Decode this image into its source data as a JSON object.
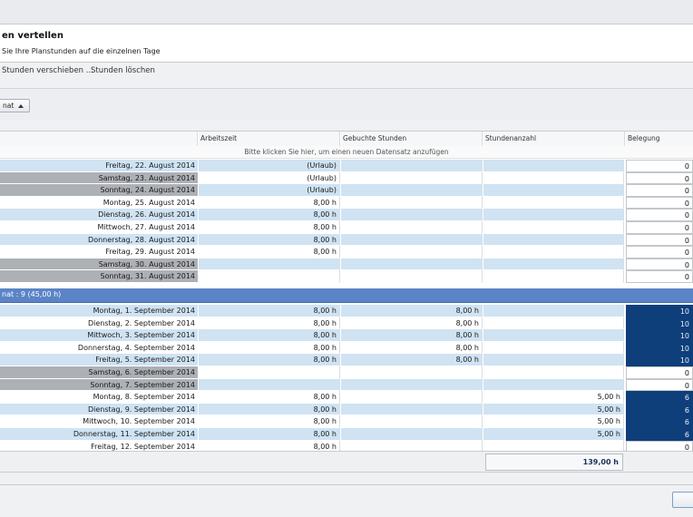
{
  "header": {
    "title": "en vertellen",
    "subtitle": "Sie Ihre Planstunden auf die einzelnen Tage"
  },
  "toolbar": {
    "move_label": "Stunden verschieben ...",
    "delete_label": "Stunden löschen"
  },
  "group_panel": {
    "chip_label": "nat"
  },
  "grid": {
    "columns": [
      "Arbeitszeit",
      "Gebuchte Stunden",
      "Stundenanzahl",
      "Belegung"
    ],
    "new_row_hint": "Bitte klicken Sie hier, um einen neuen Datensatz anzufügen",
    "rows_august": [
      {
        "date": "Freitag, 22. August 2014",
        "arbeitszeit": "(Urlaub)",
        "gebucht": "",
        "stunden": "",
        "belegung": "0"
      },
      {
        "date": "Samstag, 23. August 2014",
        "arbeitszeit": "(Urlaub)",
        "gebucht": "",
        "stunden": "",
        "belegung": "0"
      },
      {
        "date": "Sonntag, 24. August 2014",
        "arbeitszeit": "(Urlaub)",
        "gebucht": "",
        "stunden": "",
        "belegung": "0"
      },
      {
        "date": "Montag, 25. August 2014",
        "arbeitszeit": "8,00 h",
        "gebucht": "",
        "stunden": "",
        "belegung": "0"
      },
      {
        "date": "Dienstag, 26. August 2014",
        "arbeitszeit": "8,00 h",
        "gebucht": "",
        "stunden": "",
        "belegung": "0"
      },
      {
        "date": "Mittwoch, 27. August 2014",
        "arbeitszeit": "8,00 h",
        "gebucht": "",
        "stunden": "",
        "belegung": "0"
      },
      {
        "date": "Donnerstag, 28. August 2014",
        "arbeitszeit": "8,00 h",
        "gebucht": "",
        "stunden": "",
        "belegung": "0"
      },
      {
        "date": "Freitag, 29. August 2014",
        "arbeitszeit": "8,00 h",
        "gebucht": "",
        "stunden": "",
        "belegung": "0"
      },
      {
        "date": "Samstag, 30. August 2014",
        "arbeitszeit": "",
        "gebucht": "",
        "stunden": "",
        "belegung": "0"
      },
      {
        "date": "Sonntag, 31. August 2014",
        "arbeitszeit": "",
        "gebucht": "",
        "stunden": "",
        "belegung": "0"
      }
    ],
    "group_label": "nat : 9 (45,00 h)",
    "rows_september": [
      {
        "date": "Montag, 1. September 2014",
        "arbeitszeit": "8,00 h",
        "gebucht": "8,00 h",
        "stunden": "",
        "belegung": "10"
      },
      {
        "date": "Dienstag, 2. September 2014",
        "arbeitszeit": "8,00 h",
        "gebucht": "8,00 h",
        "stunden": "",
        "belegung": "10"
      },
      {
        "date": "Mittwoch, 3. September 2014",
        "arbeitszeit": "8,00 h",
        "gebucht": "8,00 h",
        "stunden": "",
        "belegung": "10"
      },
      {
        "date": "Donnerstag, 4. September 2014",
        "arbeitszeit": "8,00 h",
        "gebucht": "8,00 h",
        "stunden": "",
        "belegung": "10"
      },
      {
        "date": "Freitag, 5. September 2014",
        "arbeitszeit": "8,00 h",
        "gebucht": "8,00 h",
        "stunden": "",
        "belegung": "10"
      },
      {
        "date": "Samstag, 6. September 2014",
        "arbeitszeit": "",
        "gebucht": "",
        "stunden": "",
        "belegung": "0"
      },
      {
        "date": "Sonntag, 7. September 2014",
        "arbeitszeit": "",
        "gebucht": "",
        "stunden": "",
        "belegung": "0"
      },
      {
        "date": "Montag, 8. September 2014",
        "arbeitszeit": "8,00 h",
        "gebucht": "",
        "stunden": "5,00 h",
        "belegung": "6"
      },
      {
        "date": "Dienstag, 9. September 2014",
        "arbeitszeit": "8,00 h",
        "gebucht": "",
        "stunden": "5,00 h",
        "belegung": "6"
      },
      {
        "date": "Mittwoch, 10. September 2014",
        "arbeitszeit": "8,00 h",
        "gebucht": "",
        "stunden": "5,00 h",
        "belegung": "6"
      },
      {
        "date": "Donnerstag, 11. September 2014",
        "arbeitszeit": "8,00 h",
        "gebucht": "",
        "stunden": "5,00 h",
        "belegung": "6"
      },
      {
        "date": "Freitag, 12. September 2014",
        "arbeitszeit": "8,00 h",
        "gebucht": "",
        "stunden": "",
        "belegung": "0"
      }
    ]
  },
  "footer": {
    "total": "139,00 h"
  },
  "colors": {
    "row_blue": "#cfe3f3",
    "weekend_gray": "#adb0b5",
    "group_blue": "#5a84c6",
    "belegung_full": "#0e3f7a"
  }
}
